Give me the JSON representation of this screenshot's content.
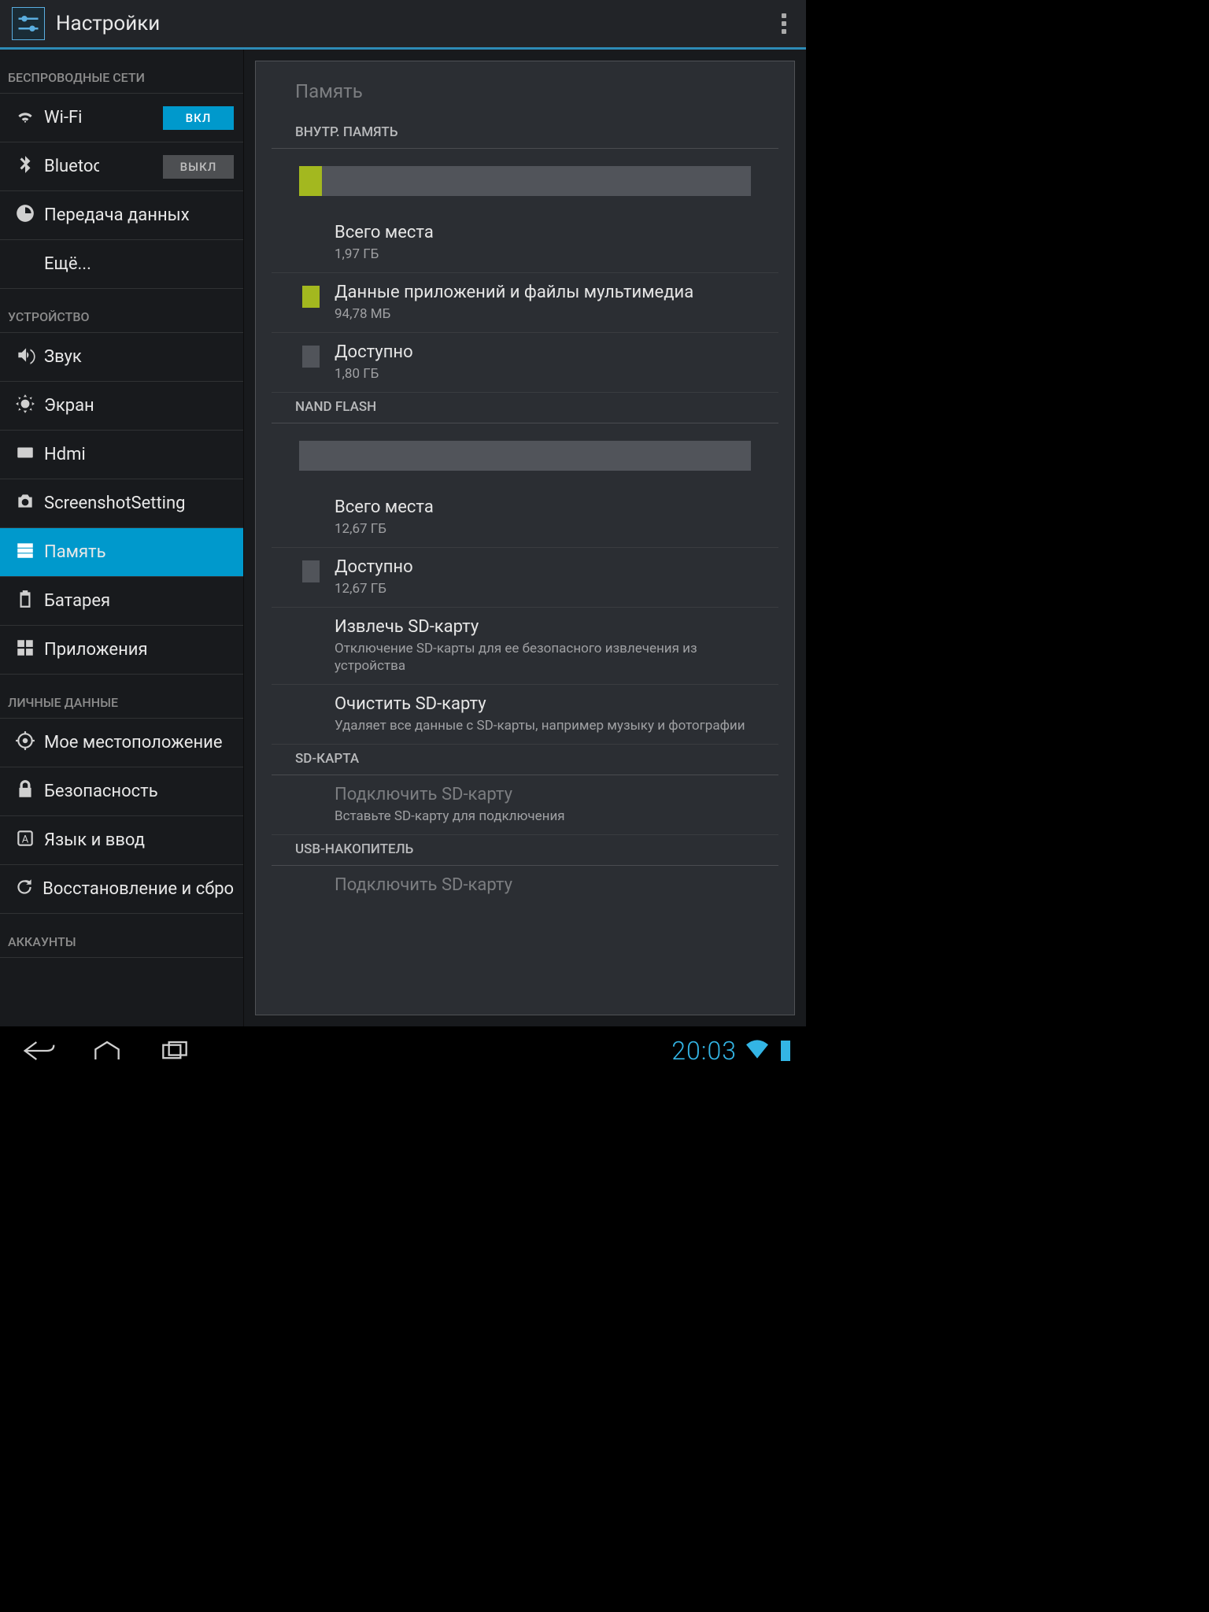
{
  "header": {
    "title": "Настройки"
  },
  "sidebar": {
    "cat_wireless": "БЕСПРОВОДНЫЕ СЕТИ",
    "wifi": {
      "label": "Wi-Fi",
      "toggle": "ВКЛ"
    },
    "bluetooth": {
      "label": "Bluetooth",
      "toggle": "ВЫКЛ"
    },
    "data": {
      "label": "Передача данных"
    },
    "more": {
      "label": "Ещё..."
    },
    "cat_device": "УСТРОЙСТВО",
    "sound": {
      "label": "Звук"
    },
    "display": {
      "label": "Экран"
    },
    "hdmi": {
      "label": "Hdmi"
    },
    "sshot": {
      "label": "ScreenshotSetting"
    },
    "storage": {
      "label": "Память"
    },
    "battery": {
      "label": "Батарея"
    },
    "apps": {
      "label": "Приложения"
    },
    "cat_personal": "ЛИЧНЫЕ ДАННЫЕ",
    "location": {
      "label": "Мое местоположение"
    },
    "security": {
      "label": "Безопасность"
    },
    "lang": {
      "label": "Язык и ввод"
    },
    "backup": {
      "label": "Восстановление и сброс"
    },
    "cat_accounts": "АККАУНТЫ"
  },
  "main": {
    "title": "Память",
    "internal": {
      "header": "ВНУТР. ПАМЯТЬ",
      "total": {
        "label": "Всего места",
        "value": "1,97 ГБ"
      },
      "apps": {
        "label": "Данные приложений и файлы мультимедиа",
        "value": "94,78 МБ"
      },
      "avail": {
        "label": "Доступно",
        "value": "1,80 ГБ"
      }
    },
    "nand": {
      "header": "NAND FLASH",
      "total": {
        "label": "Всего места",
        "value": "12,67 ГБ"
      },
      "avail": {
        "label": "Доступно",
        "value": "12,67 ГБ"
      },
      "unmount": {
        "label": "Извлечь SD-карту",
        "desc": "Отключение SD-карты для ее безопасного извлечения из устройства"
      },
      "erase": {
        "label": "Очистить SD-карту",
        "desc": "Удаляет все данные с SD-карты, например музыку и фотографии"
      }
    },
    "sdcard": {
      "header": "SD-КАРТА",
      "mount": {
        "label": "Подключить SD-карту",
        "desc": "Вставьте SD-карту для подключения"
      }
    },
    "usb": {
      "header": "USB-НАКОПИТЕЛЬ",
      "mount": {
        "label": "Подключить SD-карту"
      }
    }
  },
  "chart_data": [
    {
      "type": "bar",
      "title": "ВНУТР. ПАМЯТЬ",
      "total_gb": 1.97,
      "series": [
        {
          "name": "Данные приложений и файлы мультимедиа",
          "value_mb": 94.78,
          "color": "#a3b81f"
        }
      ],
      "available_gb": 1.8,
      "percent_used": 5
    },
    {
      "type": "bar",
      "title": "NAND FLASH",
      "total_gb": 12.67,
      "series": [],
      "available_gb": 12.67,
      "percent_used": 0
    }
  ],
  "statusbar": {
    "time": "20:03"
  }
}
